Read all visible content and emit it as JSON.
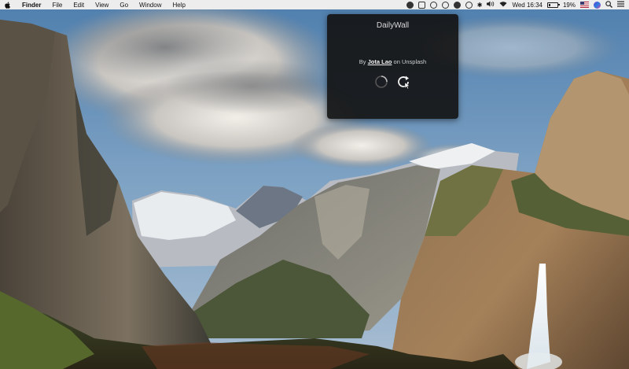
{
  "menubar": {
    "apple_icon": "apple-icon",
    "app_name": "Finder",
    "menus": [
      "File",
      "Edit",
      "View",
      "Go",
      "Window",
      "Help"
    ],
    "clock": "Wed 16:34",
    "battery_percent": "19%",
    "tray_icons": [
      "record-icon",
      "camera-icon",
      "dropbox-icon",
      "info-icon",
      "lock-icon",
      "time-machine-icon",
      "bluetooth-icon",
      "volume-icon",
      "wifi-icon"
    ]
  },
  "popover": {
    "title": "DailyWall",
    "credit_prefix": "By ",
    "author": "Jota Lao",
    "credit_suffix": " on Unsplash",
    "loading_icon": "loading-spinner-icon",
    "refresh_icon": "refresh-icon"
  },
  "colors": {
    "menubar_bg": "#ededed",
    "popover_bg": "#141414"
  }
}
